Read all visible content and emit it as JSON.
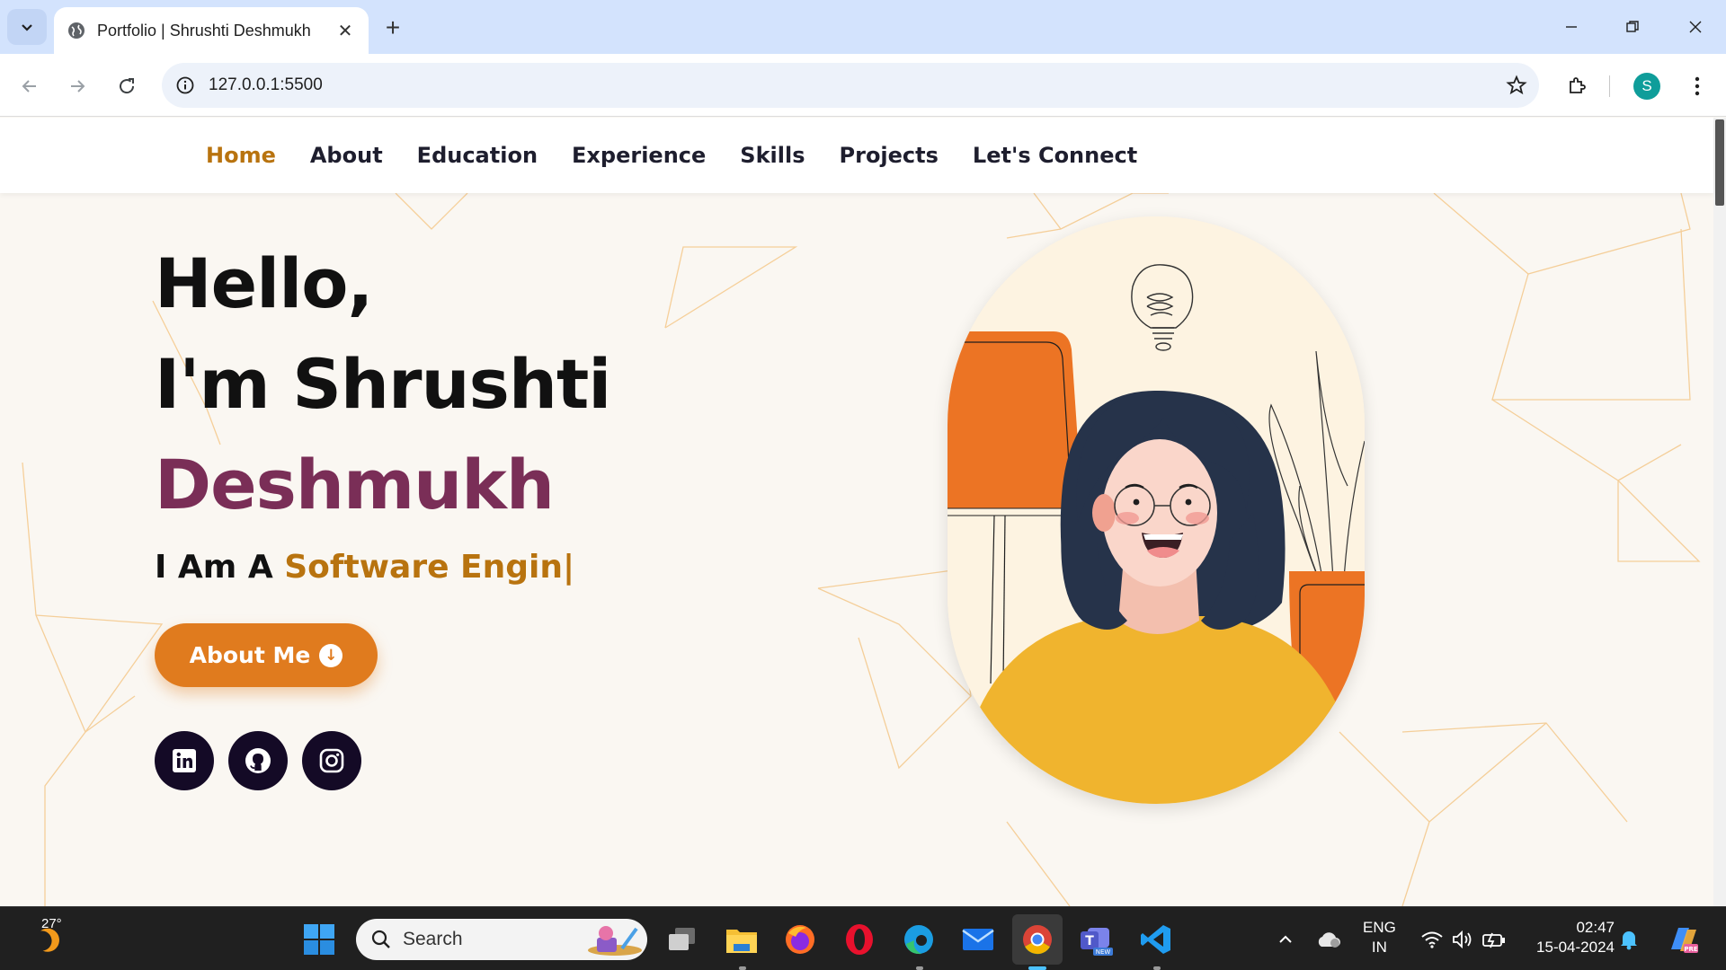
{
  "browser": {
    "tab_title": "Portfolio | Shrushti Deshmukh",
    "url": "127.0.0.1:5500",
    "profile_initial": "S"
  },
  "nav": {
    "items": [
      {
        "label": "Home",
        "active": true
      },
      {
        "label": "About",
        "active": false
      },
      {
        "label": "Education",
        "active": false
      },
      {
        "label": "Experience",
        "active": false
      },
      {
        "label": "Skills",
        "active": false
      },
      {
        "label": "Projects",
        "active": false
      },
      {
        "label": "Let's Connect",
        "active": false
      }
    ]
  },
  "hero": {
    "line1": "Hello,",
    "line2": "I'm Shrushti",
    "line3": "Deshmukh",
    "role_prefix": "I Am A ",
    "role_typed": "Software Engin|",
    "about_button": "About Me",
    "socials": [
      "linkedin-icon",
      "github-icon",
      "instagram-icon"
    ]
  },
  "taskbar": {
    "weather_temp": "27°",
    "search_placeholder": "Search",
    "lang_line1": "ENG",
    "lang_line2": "IN",
    "time": "02:47",
    "date": "15-04-2024"
  },
  "colors": {
    "accent_orange": "#e07b1e",
    "name_purple": "#7a2e57",
    "nav_active": "#b8730f",
    "social_bg": "#140a26"
  }
}
